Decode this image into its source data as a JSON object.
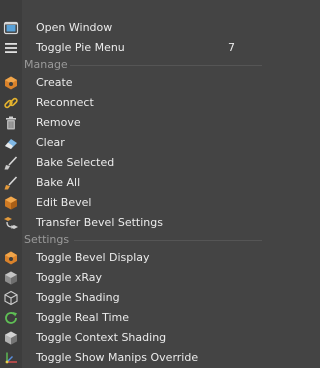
{
  "menu": {
    "top_items": [
      {
        "label": "Open Window",
        "icon": "window-icon"
      },
      {
        "label": "Toggle Pie Menu",
        "icon": "menu-list-icon",
        "shortcut": "7"
      }
    ],
    "sections": [
      {
        "title": "Manage",
        "items": [
          {
            "label": "Create",
            "icon": "create-bevel-icon"
          },
          {
            "label": "Reconnect",
            "icon": "chain-link-icon"
          },
          {
            "label": "Remove",
            "icon": "trash-icon"
          },
          {
            "label": "Clear",
            "icon": "eraser-icon"
          },
          {
            "label": "Bake Selected",
            "icon": "bake-brush-icon"
          },
          {
            "label": "Bake All",
            "icon": "bake-all-icon"
          },
          {
            "label": "Edit Bevel",
            "icon": "edit-cube-icon"
          },
          {
            "label": "Transfer Bevel Settings",
            "icon": "transfer-icon"
          }
        ]
      },
      {
        "title": "Settings",
        "items": [
          {
            "label": "Toggle Bevel Display",
            "icon": "bevel-display-icon"
          },
          {
            "label": "Toggle xRay",
            "icon": "xray-cube-icon"
          },
          {
            "label": "Toggle Shading",
            "icon": "shading-cube-icon"
          },
          {
            "label": "Toggle Real Time",
            "icon": "refresh-icon"
          },
          {
            "label": "Toggle Context Shading",
            "icon": "context-shading-icon"
          },
          {
            "label": "Toggle Show Manips Override",
            "icon": "manipulator-axes-icon"
          }
        ]
      }
    ]
  }
}
